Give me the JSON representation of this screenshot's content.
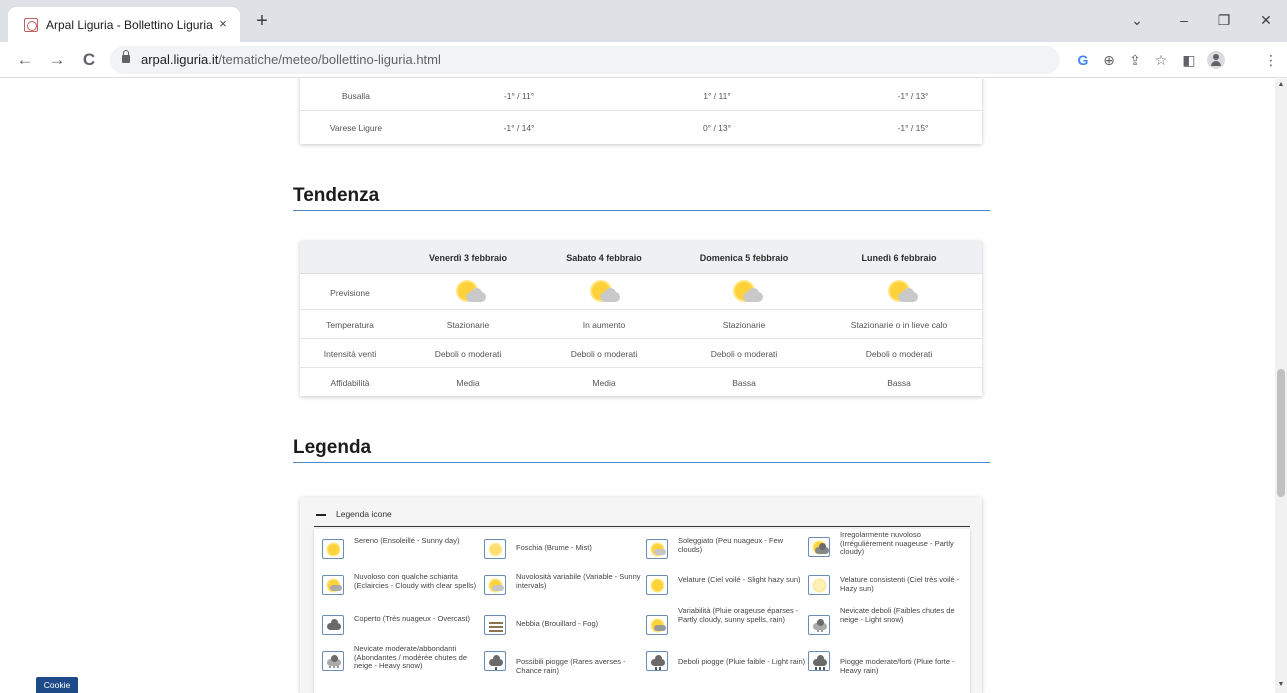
{
  "browser": {
    "tab_title": "Arpal Liguria - Bollettino Liguria",
    "tab_close": "×",
    "new_tab": "+",
    "url_domain": "arpal.liguria.it",
    "url_path": "/tematiche/meteo/bollettino-liguria.html",
    "icons": {
      "back": "←",
      "forward": "→",
      "reload": "C",
      "google": "G",
      "zoom": "⊕",
      "share": "⇪",
      "star": "☆",
      "sidepanel": "◧",
      "menu": "⋮",
      "minimize": "–",
      "restore": "❐",
      "close": "✕",
      "tabsearch": "⌄"
    }
  },
  "temps_table": {
    "rows": [
      {
        "city": "Busalla",
        "values": [
          "-1° / 11°",
          "1° / 11°",
          "-1° / 13°"
        ]
      },
      {
        "city": "Varese Ligure",
        "values": [
          "-1° / 14°",
          "0° / 13°",
          "-1° / 15°"
        ]
      }
    ]
  },
  "tendenza": {
    "title": "Tendenza",
    "days": [
      "Venerdì 3 febbraio",
      "Sabato 4 febbraio",
      "Domenica 5 febbraio",
      "Lunedì 6 febbraio"
    ],
    "rows": [
      {
        "label": "Previsione",
        "icon": "sunny-cloud-icon"
      },
      {
        "label": "Temperatura",
        "values": [
          "Stazionarie",
          "In aumento",
          "Stazionarie",
          "Stazionarie o in lieve calo"
        ]
      },
      {
        "label": "Intensità venti",
        "values": [
          "Deboli o moderati",
          "Deboli o moderati",
          "Deboli o moderati",
          "Deboli o moderati"
        ]
      },
      {
        "label": "Affidabilità",
        "values": [
          "Media",
          "Media",
          "Bassa",
          "Bassa"
        ]
      }
    ]
  },
  "legenda": {
    "title": "Legenda",
    "panel_title": "Legenda icone",
    "items": [
      {
        "icon": "sun-icon",
        "text": "Sereno (Ensoleillé - Sunny day)"
      },
      {
        "icon": "haze-sun-icon",
        "text": "Foschia (Brume - Mist)"
      },
      {
        "icon": "sun-few-clouds-icon",
        "text": "Soleggiato (Peu nuageux - Few clouds)"
      },
      {
        "icon": "partly-cloudy-icon",
        "text": "Irregolarmente nuvoloso (Irrégulièrement nuageuse - Partly cloudy)"
      },
      {
        "icon": "cloudy-clear-spells-icon",
        "text": "Nuvoloso con qualche schiarita (Eclaircies - Cloudy with clear spells)"
      },
      {
        "icon": "sunny-intervals-icon",
        "text": "Nuvolosità variabile (Variable - Sunny intervals)"
      },
      {
        "icon": "slight-hazy-sun-icon",
        "text": "Velature (Ciel voilé - Slight hazy sun)"
      },
      {
        "icon": "hazy-sun-icon",
        "text": "Velature consistenti (Ciel très voilé - Hazy sun)"
      },
      {
        "icon": "overcast-icon",
        "text": "Coperto (Très nuageux - Overcast)"
      },
      {
        "icon": "fog-icon",
        "text": "Nebbia (Brouillard - Fog)"
      },
      {
        "icon": "sunny-spells-rain-icon",
        "text": "Variabilità (Pluie orageuse éparses - Partly cloudy, sunny spells, rain)"
      },
      {
        "icon": "light-snow-icon",
        "text": "Nevicate deboli (Faibles chutes de neige - Light snow)"
      },
      {
        "icon": "heavy-snow-icon",
        "text": "Nevicate moderate/abbondanti (Abondantes / modérée chutes de neige - Heavy snow)"
      },
      {
        "icon": "chance-rain-icon",
        "text": "Possibili piogge (Rares averses - Chance rain)"
      },
      {
        "icon": "light-rain-icon",
        "text": "Deboli piogge (Pluie faible - Light rain)"
      },
      {
        "icon": "heavy-rain-icon",
        "text": "Piogge moderate/forti (Pluie forte - Heavy rain)"
      }
    ]
  },
  "cookie_label": "Cookie"
}
